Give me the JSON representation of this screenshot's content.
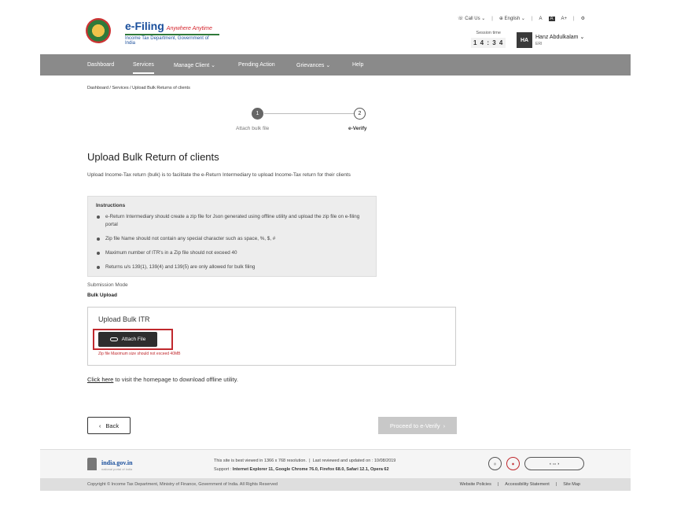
{
  "header": {
    "logo_title": "e-Filing",
    "logo_tagline": "Anywhere Anytime",
    "logo_sub": "Income Tax Department, Government of India",
    "call_us": "Call Us",
    "language": "English",
    "font_decrease": "A",
    "font_normal": "A",
    "font_increase": "A+",
    "session_label": "Session time",
    "session_time": "1 4 : 3 4",
    "avatar_initials": "HA",
    "user_name": "Hanz Abdulkalam",
    "user_role": "ERI"
  },
  "nav": {
    "items": [
      {
        "label": "Dashboard"
      },
      {
        "label": "Services"
      },
      {
        "label": "Manage Client"
      },
      {
        "label": "Pending Action"
      },
      {
        "label": "Grievances"
      },
      {
        "label": "Help"
      }
    ]
  },
  "breadcrumb": "Dashboard  /  Services  /  Upload Bulk Returns of clients",
  "stepper": {
    "step1_num": "1",
    "step1_label": "Attach bulk file",
    "step2_num": "2",
    "step2_label": "e-Verify"
  },
  "main": {
    "title": "Upload Bulk Return of clients",
    "description": "Upload Income-Tax return (bulk) is to facilitate the e-Return Intermediary  to upload Income-Tax return for their clients",
    "instructions_title": "Instructions",
    "instructions": [
      "e-Return Intermediary should create a zip file for Json generated using offline utility and upload the zip file on e-filing portal",
      "Zip file Name should not contain any special character such as space, %, $, #",
      "Maximum number of ITR's in a Zip file should not exceed 40",
      "Returns u/s 139(1), 139(4) and 139(5) are only allowed for bulk filing"
    ],
    "submission_mode_label": "Submission Mode",
    "submission_mode_value": "Bulk Upload",
    "upload_title": "Upload Bulk ITR",
    "attach_label": "Attach File",
    "upload_hint": "Zip file Maximum size should not exceed 40MB",
    "click_here": "Click here",
    "click_here_rest": " to visit the homepage to download offline utility.",
    "back_label": "Back",
    "proceed_label": "Proceed to e-Verify"
  },
  "footer": {
    "india_title": "india.gov.in",
    "india_sub": "national portal of india",
    "best_viewed": "This site is best viewed in 1366 x 768 resolution.",
    "last_reviewed": "Last reviewed and updated on : 10/08/2019",
    "support_label": "Support : ",
    "support_browsers": "Internet Explorer 11, Google Chrome 76.0, Firefox 68.0, Safari 12.1, Opera 62",
    "copyright": "Copyright © Income Tax Department, Ministry of Finance, Government of India. All Rights Reserved",
    "links": [
      {
        "label": "Website Policies"
      },
      {
        "label": "Accessibility Statement"
      },
      {
        "label": "Site Map"
      }
    ]
  },
  "colors": {
    "nav_bg": "#8a8a8a",
    "highlight": "#c0282d",
    "brand_blue": "#1a4f9c"
  }
}
